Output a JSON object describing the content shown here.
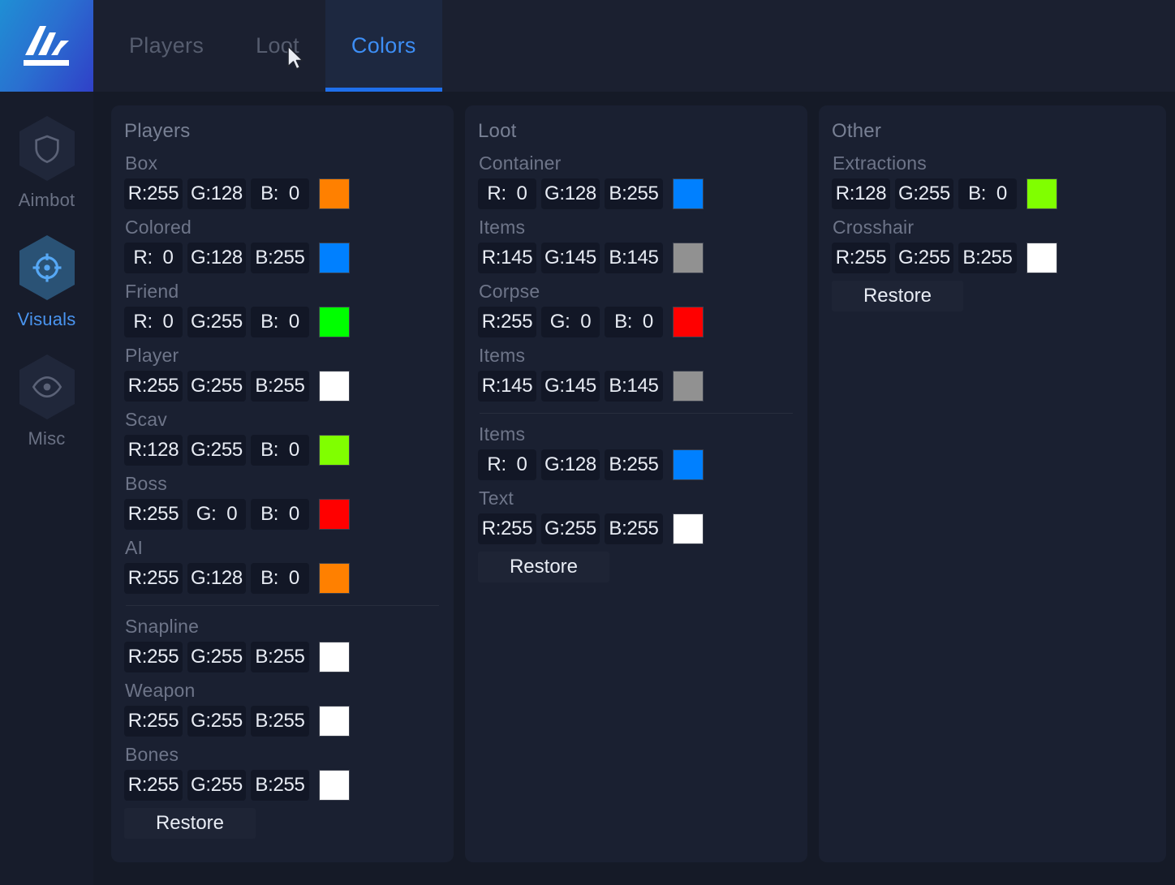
{
  "header": {
    "logo_icon": "app-logo-icon",
    "tabs": [
      {
        "label": "Players",
        "active": false
      },
      {
        "label": "Loot",
        "active": false
      },
      {
        "label": "Colors",
        "active": true
      }
    ]
  },
  "sidebar": {
    "items": [
      {
        "label": "Aimbot",
        "icon": "shield-icon",
        "active": false
      },
      {
        "label": "Visuals",
        "icon": "crosshair-icon",
        "active": true
      },
      {
        "label": "Misc",
        "icon": "eye-icon",
        "active": false
      }
    ]
  },
  "colors": {
    "accent_blue": "#1f6feb",
    "active_tab_text": "#3d8ef5",
    "panel_bg": "#1a2031",
    "input_bg": "#121726"
  },
  "panels": [
    {
      "title": "Players",
      "groups": [
        {
          "rows": [
            {
              "label": "Box",
              "r": "R:255",
              "g": "G:128",
              "b": "B:  0",
              "swatch": "#ff8000"
            },
            {
              "label": "Colored",
              "r": "R:  0",
              "g": "G:128",
              "b": "B:255",
              "swatch": "#0080ff"
            },
            {
              "label": "Friend",
              "r": "R:  0",
              "g": "G:255",
              "b": "B:  0",
              "swatch": "#00ff00"
            },
            {
              "label": "Player",
              "r": "R:255",
              "g": "G:255",
              "b": "B:255",
              "swatch": "#ffffff"
            },
            {
              "label": "Scav",
              "r": "R:128",
              "g": "G:255",
              "b": "B:  0",
              "swatch": "#80ff00"
            },
            {
              "label": "Boss",
              "r": "R:255",
              "g": "G:  0",
              "b": "B:  0",
              "swatch": "#ff0000"
            },
            {
              "label": "AI",
              "r": "R:255",
              "g": "G:128",
              "b": "B:  0",
              "swatch": "#ff8000"
            }
          ]
        },
        {
          "rows": [
            {
              "label": "Snapline",
              "r": "R:255",
              "g": "G:255",
              "b": "B:255",
              "swatch": "#ffffff"
            },
            {
              "label": "Weapon",
              "r": "R:255",
              "g": "G:255",
              "b": "B:255",
              "swatch": "#ffffff"
            },
            {
              "label": "Bones",
              "r": "R:255",
              "g": "G:255",
              "b": "B:255",
              "swatch": "#ffffff"
            }
          ]
        }
      ],
      "restore_label": "Restore"
    },
    {
      "title": "Loot",
      "groups": [
        {
          "rows": [
            {
              "label": "Container",
              "r": "R:  0",
              "g": "G:128",
              "b": "B:255",
              "swatch": "#0080ff"
            },
            {
              "label": "Items",
              "r": "R:145",
              "g": "G:145",
              "b": "B:145",
              "swatch": "#919191"
            },
            {
              "label": "Corpse",
              "r": "R:255",
              "g": "G:  0",
              "b": "B:  0",
              "swatch": "#ff0000"
            },
            {
              "label": "Items",
              "r": "R:145",
              "g": "G:145",
              "b": "B:145",
              "swatch": "#919191"
            }
          ]
        },
        {
          "rows": [
            {
              "label": "Items",
              "r": "R:  0",
              "g": "G:128",
              "b": "B:255",
              "swatch": "#0080ff"
            },
            {
              "label": "Text",
              "r": "R:255",
              "g": "G:255",
              "b": "B:255",
              "swatch": "#ffffff"
            }
          ]
        }
      ],
      "restore_label": "Restore"
    },
    {
      "title": "Other",
      "groups": [
        {
          "rows": [
            {
              "label": "Extractions",
              "r": "R:128",
              "g": "G:255",
              "b": "B:  0",
              "swatch": "#80ff00"
            },
            {
              "label": "Crosshair",
              "r": "R:255",
              "g": "G:255",
              "b": "B:255",
              "swatch": "#ffffff"
            }
          ]
        }
      ],
      "restore_label": "Restore"
    }
  ]
}
